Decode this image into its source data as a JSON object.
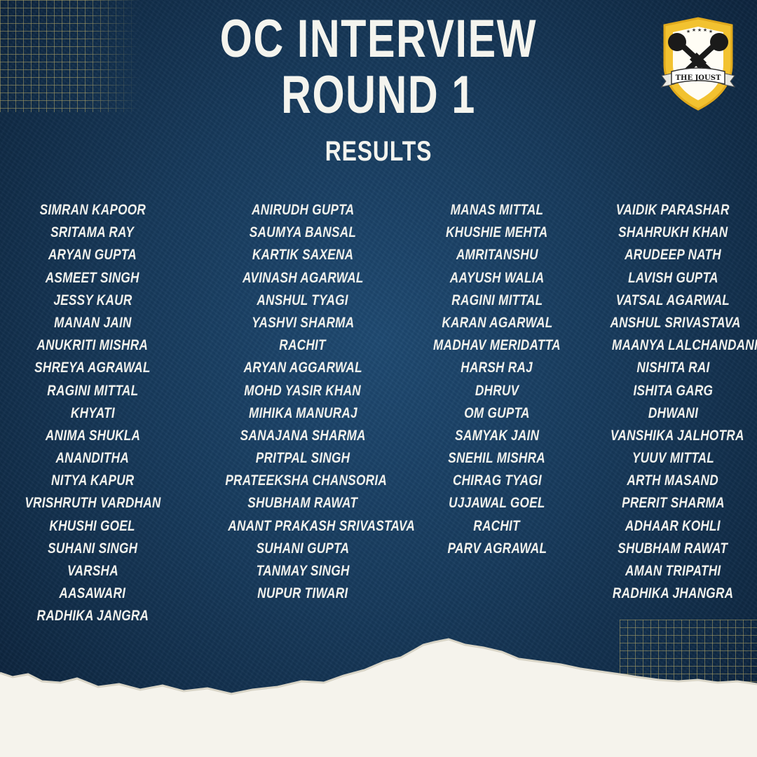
{
  "header": {
    "title_line1": "OC INTERVIEW",
    "title_line2": "ROUND 1",
    "subtitle": "RESULTS"
  },
  "logo": {
    "text": "THE JOUST",
    "icon": "crossed-microphones-shield-icon",
    "colors": {
      "shield": "#f2c230",
      "inner": "#ffffff",
      "ink": "#1a1a1a"
    }
  },
  "colors": {
    "background": "#173a5c",
    "text": "#f1f1ec",
    "grid": "#d2be6e",
    "paper": "#f5f3ec"
  },
  "columns": [
    [
      "SIMRAN KAPOOR",
      "SRITAMA RAY",
      "ARYAN GUPTA",
      "ASMEET SINGH",
      "JESSY KAUR",
      "MANAN JAIN",
      "ANUKRITI MISHRA",
      "SHREYA AGRAWAL",
      "RAGINI MITTAL",
      "KHYATI",
      "ANIMA SHUKLA",
      "ANANDITHA",
      "NITYA KAPUR",
      "VRISHRUTH VARDHAN",
      "KHUSHI GOEL",
      "SUHANI SINGH",
      "VARSHA",
      "AASAWARI",
      "RADHIKA JANGRA"
    ],
    [
      "ANIRUDH GUPTA",
      "SAUMYA BANSAL",
      "KARTIK SAXENA",
      "AVINASH AGARWAL",
      "ANSHUL TYAGI",
      "YASHVI SHARMA",
      "RACHIT",
      "ARYAN AGGARWAL",
      "MOHD YASIR KHAN",
      "MIHIKA MANURAJ",
      "SANAJANA SHARMA",
      "PRITPAL SINGH",
      "PRATEEKSHA CHANSORIA",
      "SHUBHAM RAWAT",
      "ANANT PRAKASH SRIVASTAVA",
      "SUHANI GUPTA",
      "TANMAY SINGH",
      "NUPUR TIWARI"
    ],
    [
      "MANAS MITTAL",
      "KHUSHIE MEHTA",
      "AMRITANSHU",
      "AAYUSH WALIA",
      "RAGINI MITTAL",
      "KARAN AGARWAL",
      "MADHAV MERIDATTA",
      "HARSH RAJ",
      "DHRUV",
      "OM GUPTA",
      "SAMYAK JAIN",
      "SNEHIL MISHRA",
      "CHIRAG TYAGI",
      "UJJAWAL GOEL",
      "RACHIT",
      "PARV AGRAWAL"
    ],
    [
      "VAIDIK PARASHAR",
      "SHAHRUKH KHAN",
      "ARUDEEP NATH",
      "LAVISH GUPTA",
      "VATSAL AGARWAL",
      "ANSHUL SRIVASTAVA",
      "MAANYA LALCHANDANI",
      "NISHITA RAI",
      "ISHITA GARG",
      "DHWANI",
      "VANSHIKA JALHOTRA",
      "YUUV MITTAL",
      "ARTH MASAND",
      "PRERIT SHARMA",
      "ADHAAR KOHLI",
      "SHUBHAM RAWAT",
      "AMAN TRIPATHI",
      "RADHIKA JHANGRA"
    ]
  ]
}
